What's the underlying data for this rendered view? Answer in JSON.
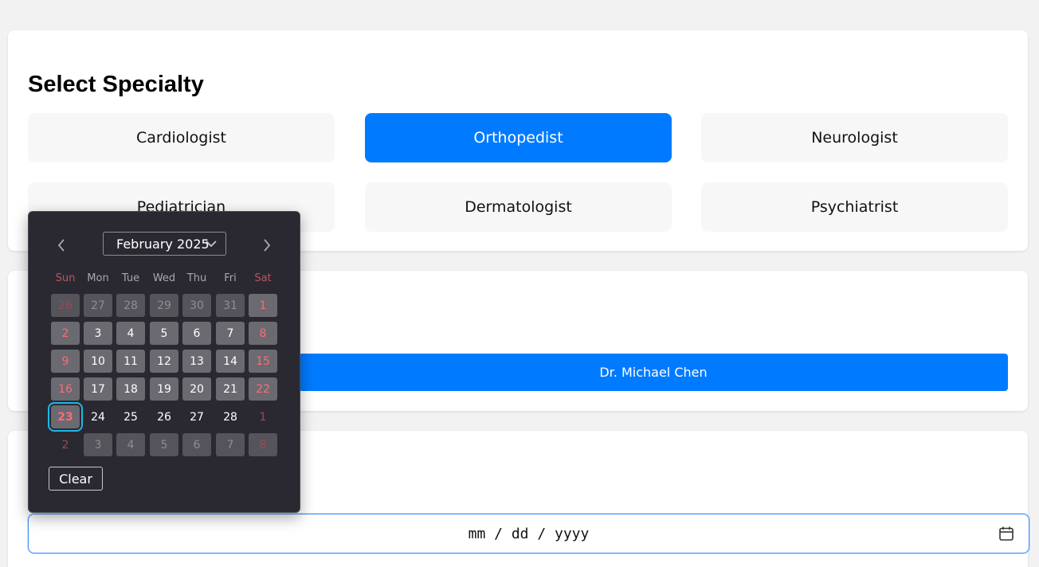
{
  "specialty": {
    "title": "Select Specialty",
    "options": [
      "Cardiologist",
      "Orthopedist",
      "Neurologist",
      "Pediatrician",
      "Dermatologist",
      "Psychiatrist"
    ],
    "selected": "Orthopedist"
  },
  "doctor": {
    "selected_label": "Dr. Michael Chen"
  },
  "date": {
    "placeholder_display": "mm / dd / yyyy"
  },
  "datepicker": {
    "month_label": "February 2025",
    "weekdays": [
      "Sun",
      "Mon",
      "Tue",
      "Wed",
      "Thu",
      "Fri",
      "Sat"
    ],
    "weeks": [
      [
        "26",
        "27",
        "28",
        "29",
        "30",
        "31",
        "1"
      ],
      [
        "2",
        "3",
        "4",
        "5",
        "6",
        "7",
        "8"
      ],
      [
        "9",
        "10",
        "11",
        "12",
        "13",
        "14",
        "15"
      ],
      [
        "16",
        "17",
        "18",
        "19",
        "20",
        "21",
        "22"
      ],
      [
        "23",
        "24",
        "25",
        "26",
        "27",
        "28",
        "1"
      ],
      [
        "2",
        "3",
        "4",
        "5",
        "6",
        "7",
        "8"
      ]
    ],
    "today": "23",
    "clear_label": "Clear"
  },
  "colors": {
    "accent": "#007bff",
    "picker_bg": "#2a2931",
    "weekend": "#ff6b78",
    "focus_ring": "#1fb6e8"
  },
  "icons": {
    "prev": "chevron-left-icon",
    "next": "chevron-right-icon",
    "dropdown": "chevron-down-icon",
    "calendar": "calendar-icon"
  }
}
